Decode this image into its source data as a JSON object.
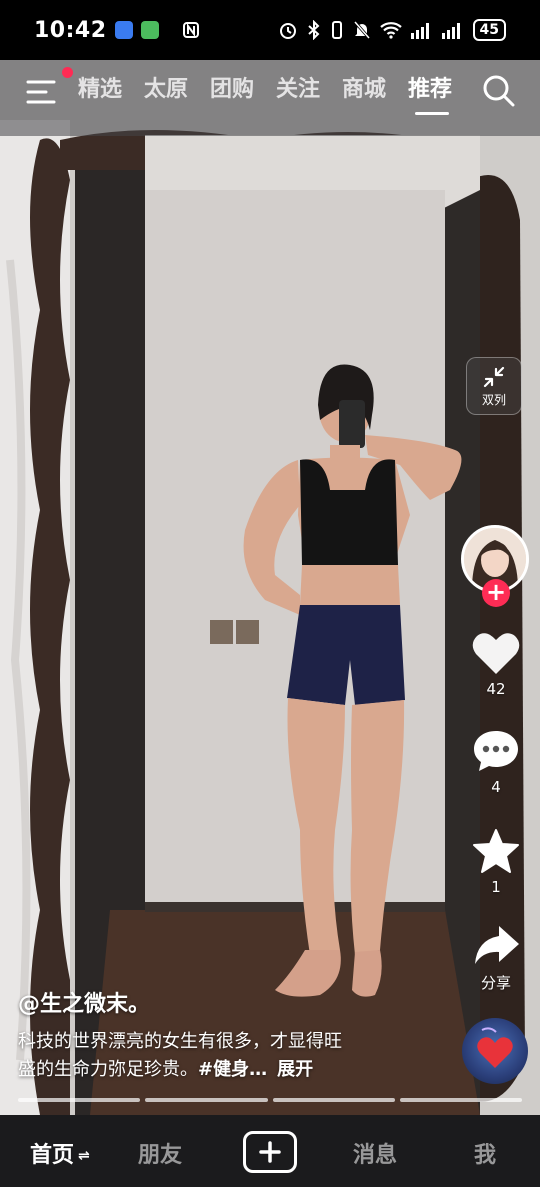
{
  "status_bar": {
    "time": "10:42",
    "right_icons": [
      "nfc-icon",
      "alarm-icon",
      "bluetooth-icon",
      "vibrate-icon",
      "mute-icon",
      "wifi-icon",
      "signal-icon",
      "signal-icon"
    ],
    "battery": "45"
  },
  "top_nav": {
    "tabs": [
      "精选",
      "太原",
      "团购",
      "关注",
      "商城",
      "推荐"
    ],
    "active_tab": "推荐",
    "has_notification_dot": true
  },
  "side": {
    "dual_column_label": "双列",
    "like_count": "42",
    "comment_count": "4",
    "favorite_count": "1",
    "share_label": "分享"
  },
  "post": {
    "author": "@生之微末。",
    "caption_line1": "科技的世界漂亮的女生有很多，才显得旺",
    "caption_line2_prefix": "盛的生命力弥足珍贵。",
    "hashtag": "#健身…",
    "expand_label": "展开"
  },
  "bottom_nav": {
    "home": "首页",
    "friends": "朋友",
    "messages": "消息",
    "me": "我"
  },
  "colors": {
    "accent_red": "#fe2c55",
    "bar_bg": "#1b1b1d"
  }
}
